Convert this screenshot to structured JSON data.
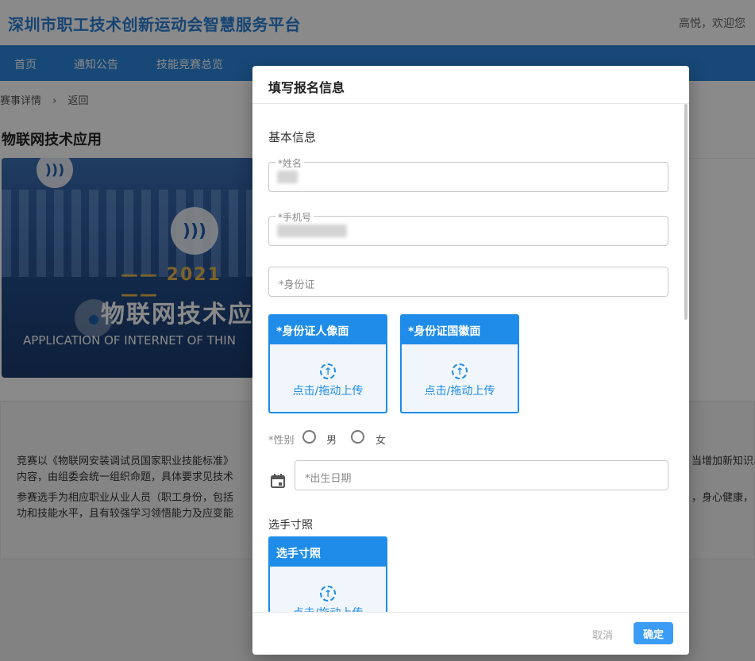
{
  "header": {
    "site_title": "深圳市职工技术创新运动会智慧服务平台",
    "welcome": "高悦，欢迎您"
  },
  "nav": {
    "items": [
      "首页",
      "通知公告",
      "技能竞赛总览"
    ]
  },
  "breadcrumb": {
    "current": "赛事详情",
    "separator": "›",
    "back": "返回"
  },
  "page": {
    "title": "物联网技术应用",
    "banner": {
      "year_line": "—— 2021 ——",
      "title": "物联网技术应",
      "subtitle": "APPLICATION OF INTERNET OF THIN"
    },
    "desc": {
      "line1_left": "竞赛以《物联网安装调试员国家职业技能标准》",
      "line1_right": "当增加新知识、",
      "line2": "内容，由组委会统一组织命题，具体要求见技术",
      "line3_left": "参赛选手为相应职业从业人员（职工身份，包括",
      "line3_right": "，身心健康，",
      "line4": "功和技能水平，且有较强学习领悟能力及应变能"
    }
  },
  "modal": {
    "title": "填写报名信息",
    "basic_info_title": "基本信息",
    "name_label": "*姓名",
    "phone_label": "*手机号",
    "id_placeholder": "*身份证",
    "upload_front": {
      "header": "*身份证人像面",
      "text": "点击/拖动上传"
    },
    "upload_back": {
      "header": "*身份证国徽面",
      "text": "点击/拖动上传"
    },
    "gender_label": "*性别",
    "gender_options": [
      "男",
      "女"
    ],
    "birth_placeholder": "*出生日期",
    "photo_section_title": "选手寸照",
    "upload_photo": {
      "header": "选手寸照",
      "text": "点击/拖动上传"
    },
    "cancel_label": "取消",
    "ok_label": "确定"
  },
  "icons": {
    "upload": "upload-arrow-icon",
    "calendar": "calendar-icon",
    "breadcrumb_sep": "chevron-right-icon"
  },
  "colors": {
    "primary": "#1e8ce8",
    "nav": "#2b86dc",
    "title": "#2a7fd4"
  }
}
